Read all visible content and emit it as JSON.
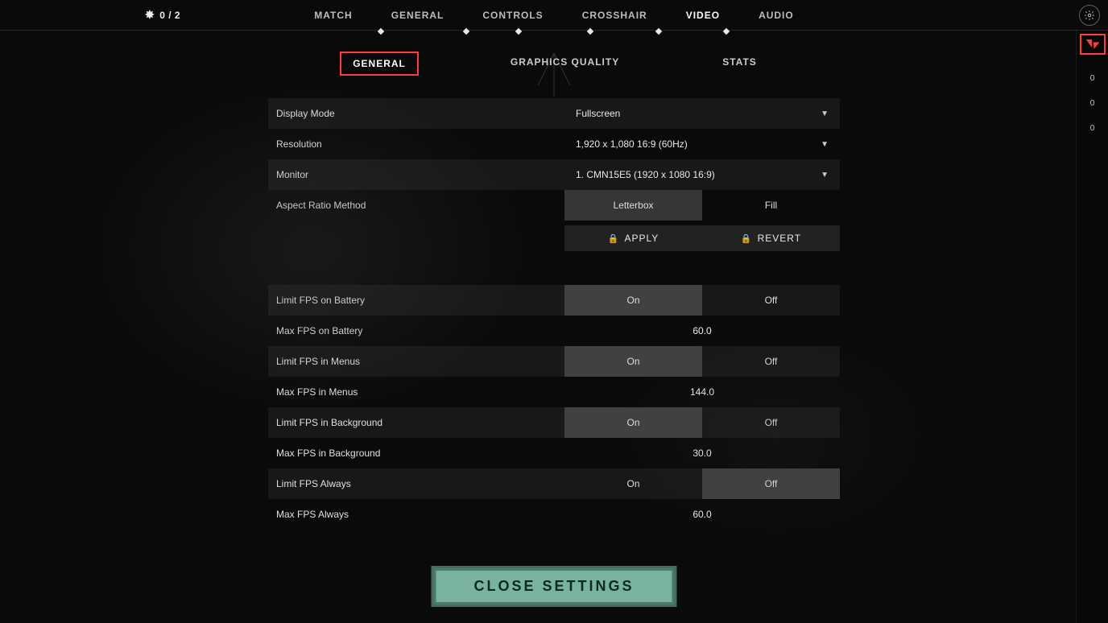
{
  "header": {
    "radianite": "0 / 2",
    "tabs": [
      "MATCH",
      "GENERAL",
      "CONTROLS",
      "CROSSHAIR",
      "VIDEO",
      "AUDIO"
    ],
    "active_tab_index": 4
  },
  "subtabs": {
    "items": [
      "GENERAL",
      "GRAPHICS QUALITY",
      "STATS"
    ],
    "highlighted_index": 0
  },
  "settings": {
    "display_mode": {
      "label": "Display Mode",
      "value": "Fullscreen"
    },
    "resolution": {
      "label": "Resolution",
      "value": "1,920 x 1,080 16:9 (60Hz)"
    },
    "monitor": {
      "label": "Monitor",
      "value": "1. CMN15E5 (1920 x  1080 16:9)"
    },
    "aspect_ratio": {
      "label": "Aspect Ratio Method",
      "options": [
        "Letterbox",
        "Fill"
      ],
      "selected": 0
    },
    "apply": "APPLY",
    "revert": "REVERT",
    "limit_fps_battery": {
      "label": "Limit FPS on Battery",
      "options": [
        "On",
        "Off"
      ],
      "selected": 0
    },
    "max_fps_battery": {
      "label": "Max FPS on Battery",
      "value": "60.0"
    },
    "limit_fps_menus": {
      "label": "Limit FPS in Menus",
      "options": [
        "On",
        "Off"
      ],
      "selected": 0
    },
    "max_fps_menus": {
      "label": "Max FPS in Menus",
      "value": "144.0"
    },
    "limit_fps_background": {
      "label": "Limit FPS in Background",
      "options": [
        "On",
        "Off"
      ],
      "selected": 0
    },
    "max_fps_background": {
      "label": "Max FPS in Background",
      "value": "30.0"
    },
    "limit_fps_always": {
      "label": "Limit FPS Always",
      "options": [
        "On",
        "Off"
      ],
      "selected": 1
    },
    "max_fps_always": {
      "label": "Max FPS Always",
      "value": "60.0"
    }
  },
  "sidebar": {
    "counts": [
      "0",
      "0",
      "0"
    ]
  },
  "close_label": "CLOSE SETTINGS"
}
